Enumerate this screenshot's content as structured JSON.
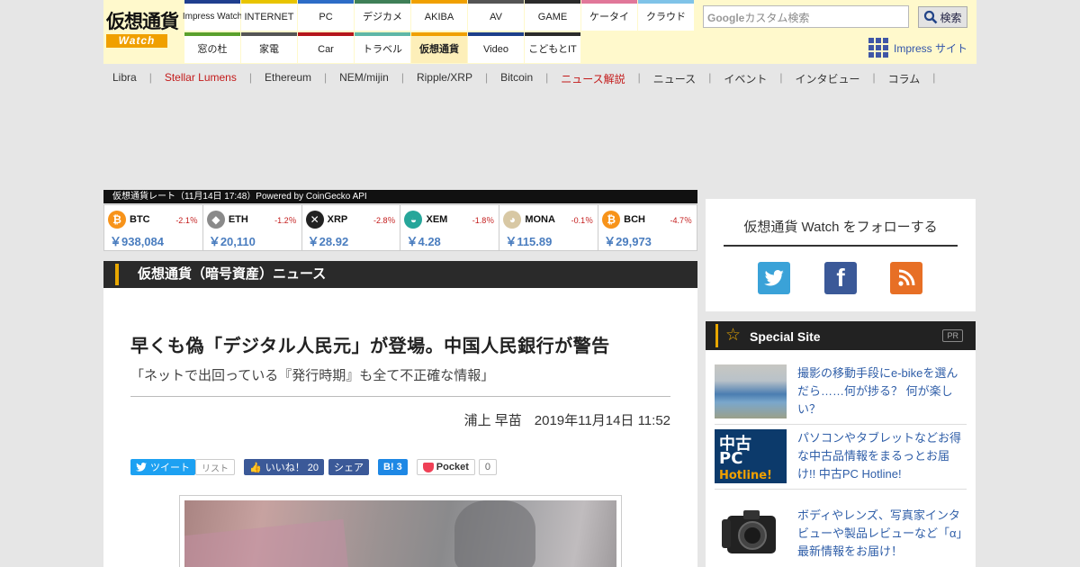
{
  "header": {
    "logo": {
      "title": "仮想通貨",
      "sub": "Watch"
    },
    "nav_row1": [
      {
        "label": "Impress Watch",
        "color": "#1f3f8f"
      },
      {
        "label": "INTERNET",
        "color": "#e8c400"
      },
      {
        "label": "PC",
        "color": "#2d6cc7"
      },
      {
        "label": "デジカメ",
        "color": "#3f7f57"
      },
      {
        "label": "AKIBA",
        "color": "#f0a000"
      },
      {
        "label": "AV",
        "color": "#555555"
      },
      {
        "label": "GAME",
        "color": "#2b2b2b"
      },
      {
        "label": "ケータイ",
        "color": "#e17799"
      },
      {
        "label": "クラウド",
        "color": "#7fc3e8"
      }
    ],
    "nav_row2": [
      {
        "label": "窓の杜",
        "color": "#5aa02c"
      },
      {
        "label": "家電",
        "color": "#555555"
      },
      {
        "label": "Car",
        "color": "#b5161c"
      },
      {
        "label": "トラベル",
        "color": "#5fb7a7"
      },
      {
        "label": "仮想通貨",
        "color": "#f0a000"
      },
      {
        "label": "Video",
        "color": "#1d3f8a"
      },
      {
        "label": "こどもとIT",
        "color": "#2b2b2b"
      },
      {
        "label": "",
        "color": "#fff9cc"
      },
      {
        "label": "",
        "color": "#fff9cc"
      }
    ],
    "search": {
      "brand": "Google",
      "placeholder": "カスタム検索",
      "button": "検索"
    },
    "impress_link": "Impress サイト"
  },
  "subnav": [
    {
      "label": "Libra",
      "red": false
    },
    {
      "label": "Stellar Lumens",
      "red": true
    },
    {
      "label": "Ethereum",
      "red": false
    },
    {
      "label": "NEM/mijin",
      "red": false
    },
    {
      "label": "Ripple/XRP",
      "red": false
    },
    {
      "label": "Bitcoin",
      "red": false
    },
    {
      "label": "ニュース解説",
      "red": true
    },
    {
      "label": "ニュース",
      "red": false
    },
    {
      "label": "イベント",
      "red": false
    },
    {
      "label": "インタビュー",
      "red": false
    },
    {
      "label": "コラム",
      "red": false
    }
  ],
  "rates": {
    "heading": "仮想通貨レート（11月14日 17:48）Powered by CoinGecko API",
    "items": [
      {
        "symbol": "BTC",
        "change": "-2.1％",
        "price": "￥938,084",
        "color": "#f7931a",
        "glyph": "₿"
      },
      {
        "symbol": "ETH",
        "change": "-1.2％",
        "price": "￥20,110",
        "color": "#8a8a8a",
        "glyph": "◆"
      },
      {
        "symbol": "XRP",
        "change": "-2.8％",
        "price": "￥28.92",
        "color": "#222222",
        "glyph": "✕"
      },
      {
        "symbol": "XEM",
        "change": "-1.8％",
        "price": "￥4.28",
        "color": "#26a69a",
        "glyph": "◒"
      },
      {
        "symbol": "MONA",
        "change": "-0.1％",
        "price": "￥115.89",
        "color": "#d8c8a4",
        "glyph": "◕"
      },
      {
        "symbol": "BCH",
        "change": "-4.7％",
        "price": "￥29,973",
        "color": "#f7931a",
        "glyph": "₿"
      }
    ]
  },
  "section_title": "仮想通貨（暗号資産）ニュース",
  "article": {
    "title": "早くも偽「デジタル人民元」が登場。中国人民銀行が警告",
    "subtitle": "「ネットで出回っている『発行時期』も全て不正確な情報」",
    "author": "浦上 早苗",
    "date": "2019年11月14日 11:52"
  },
  "share": {
    "tweet": "ツイート",
    "list": "リスト",
    "like": "いいね！ 20",
    "fb_share": "シェア",
    "hatena": "B! 3",
    "pocket": "Pocket",
    "pocket_count": "0"
  },
  "sidebar": {
    "follow_title": "仮想通貨 Watch をフォローする",
    "sns": [
      {
        "name": "twitter",
        "color": "#3aa2d8",
        "glyph": "🐦"
      },
      {
        "name": "facebook",
        "color": "#3b5998",
        "glyph": "f"
      },
      {
        "name": "rss",
        "color": "#e76f25",
        "glyph": "◉"
      }
    ],
    "special_title": "Special Site",
    "pr": "PR",
    "special_items": [
      {
        "text": "撮影の移動手段にe-bikeを選んだら……何が捗る？ 何が楽しい？"
      },
      {
        "text": "パソコンやタブレットなどお得な中古品情報をまるっとお届け!! 中古PC Hotline!",
        "thumb_lines": [
          "中古",
          "PC",
          "Hotline!"
        ]
      },
      {
        "text": "ボディやレンズ、写真家インタビューや製品レビューなど「α」最新情報をお届け！"
      }
    ]
  }
}
